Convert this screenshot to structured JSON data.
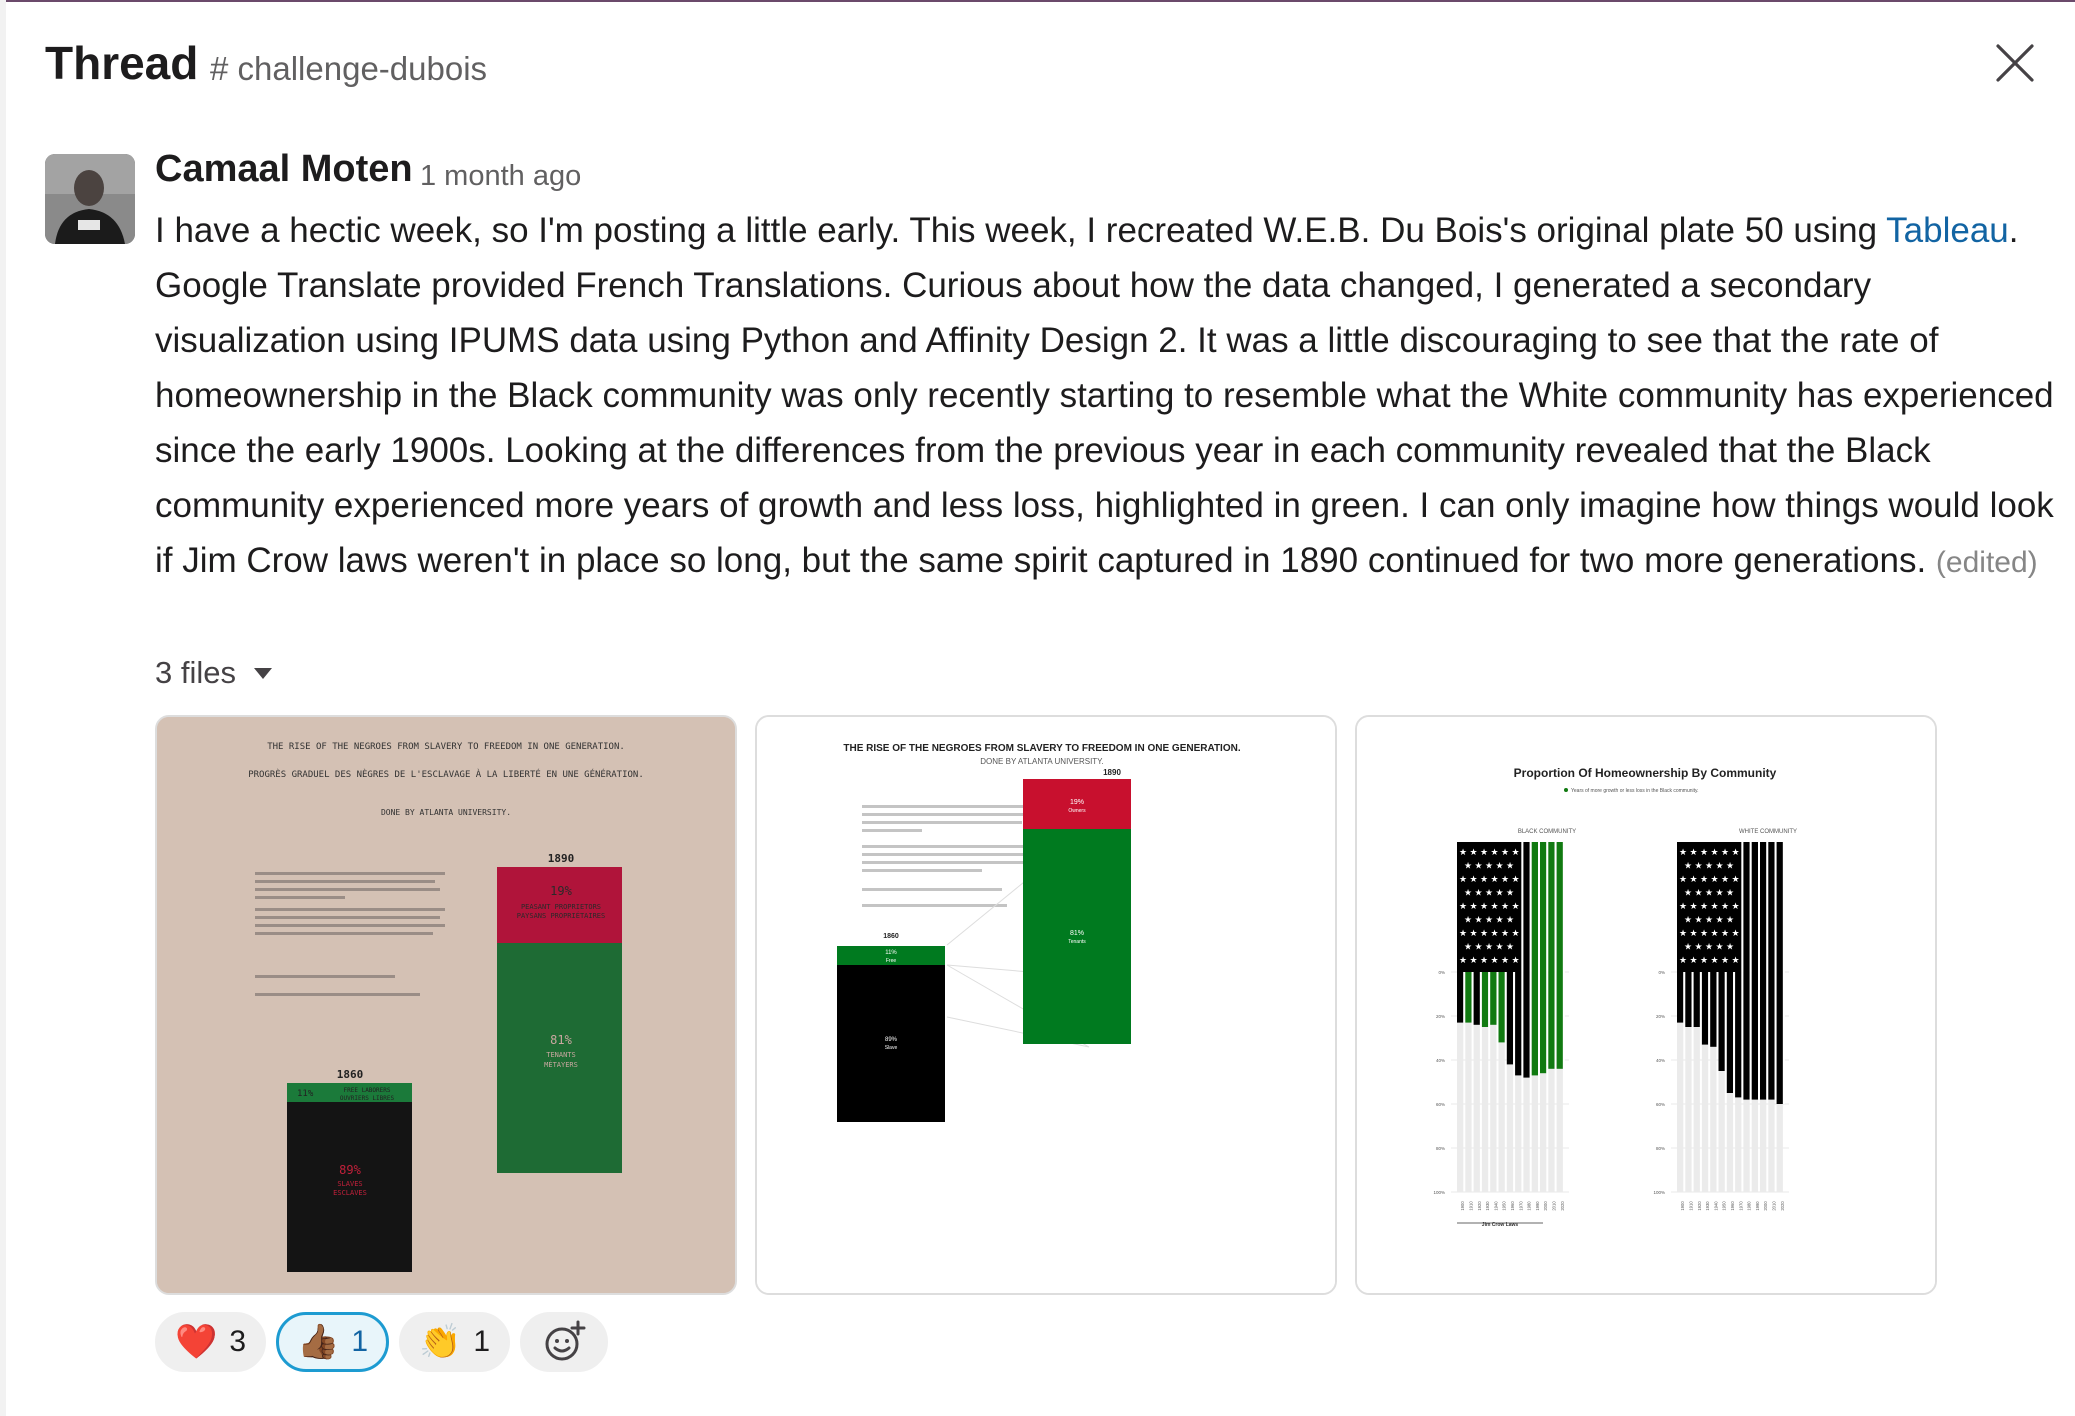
{
  "header": {
    "title": "Thread",
    "channel": "# challenge-dubois"
  },
  "message": {
    "author": "Camaal Moten",
    "timestamp": "1 month ago",
    "text_part1": "I have a hectic week, so I'm posting a little early. This week, I recreated W.E.B. Du Bois's original plate 50 using ",
    "link_text": "Tableau",
    "text_part2": ". Google Translate provided French Translations. Curious about how the data changed, I generated a secondary visualization using IPUMS data using Python and Affinity Design 2. It was a little discouraging to see that the rate of homeownership in the Black community was only recently starting to resemble what the White community has experienced since the early 1900s. Looking at the differences from the previous year in each community revealed that the Black community experienced more years of growth and less loss, highlighted in green. I can only imagine how things would look if Jim Crow laws weren't in place so long, but the same spirit captured in 1890 continued for two more generations. ",
    "edited": "(edited)",
    "files_label": "3 files"
  },
  "files": {
    "plate1": {
      "title_line1": "THE RISE OF THE NEGROES FROM SLAVERY TO FREEDOM IN ONE GENERATION.",
      "title_line2": "PROGRÈS GRADUEL DES NÈGRES DE L'ESCLAVAGE À LA LIBERTÉ EN UNE GÉNÉRATION.",
      "credit": "DONE BY ATLANTA UNIVERSITY.",
      "year_1890": "1890",
      "year_1860": "1860",
      "pct_19": "19%",
      "pct_81": "81%",
      "pct_11": "11%",
      "pct_89": "89%",
      "label_owners": "PEASANT PROPRIETORS",
      "label_owners_fr": "PAYSANS PROPRIÉTAIRES",
      "label_tenants": "TENANTS",
      "label_tenants_fr": "MÉTAYERS",
      "label_free": "FREE LABORERS",
      "label_free_fr": "OUVRIERS LIBRES",
      "label_slaves": "SLAVES",
      "label_slaves_fr": "ESCLAVES"
    },
    "plate2": {
      "title": "THE RISE OF THE NEGROES FROM SLAVERY TO FREEDOM IN ONE GENERATION.",
      "credit": "DONE BY ATLANTA UNIVERSITY.",
      "note1": "IN 1890 NEARLY ONE FIFTH OF THEM OWNED THEIR OWN HOMES AND FARMS. THIS ADVANCE WAS ACCOMPLISHED ENTIRELY WITHOUT STATE AID, AND IN THE FACE OF PROSCRIPTIVE LAWS.",
      "note2": "EN 1890, PRÈS D'UN CINQUIÈME D'ENTRE EUX POSSÉDAIENT LEUR PROPRE MAISON ET FERME. CETTE AVANCÉE A ÉTÉ RÉALISÉE ENTIÈREMENT SANS AIDE DE L'ÉTAT ET FACE À DES LOIS PROSCRIPTIVES.",
      "note3": "IN 1860 89% OF THE BLACKS WERE SLAVES.",
      "note4": "EN 1860, 90 % DES NOIRS ÉTAIT DES ESCLAVES.",
      "year_1890": "1890",
      "year_1860": "1860",
      "owners_pct": "19%",
      "owners_label": "Owners",
      "tenants_pct": "81%",
      "tenants_label": "Tenants",
      "free_pct": "11%",
      "free_label": "Free",
      "slave_pct": "89%",
      "slave_label": "Slave"
    },
    "plate3": {
      "title": "Proportion Of Homeownership By Community",
      "legend": "Years of more growth or less loss in the Black community.",
      "black_label": "BLACK COMMUNITY",
      "white_label": "WHITE COMMUNITY",
      "y_ticks": [
        "0%",
        "20%",
        "40%",
        "60%",
        "80%",
        "100%"
      ],
      "x_ticks": [
        "1900",
        "1910",
        "1920",
        "1930",
        "1940",
        "1950",
        "1960",
        "1970",
        "1980",
        "1990",
        "2000",
        "2010",
        "2020"
      ],
      "jim_crow": "Jim Crow Laws",
      "colors": {
        "black": "#000000",
        "green": "#117a11",
        "grey": "#ebebeb"
      }
    }
  },
  "reactions": [
    {
      "emoji": "❤️",
      "count": "3",
      "name": "heart"
    },
    {
      "emoji": "👍🏾",
      "count": "1",
      "name": "thumbsup"
    },
    {
      "emoji": "👏",
      "count": "1",
      "name": "clap"
    }
  ],
  "chart_data": [
    {
      "type": "bar",
      "title": "THE RISE OF THE NEGROES FROM SLAVERY TO FREEDOM IN ONE GENERATION.",
      "categories": [
        "1860",
        "1890"
      ],
      "series": [
        {
          "name": "Slave",
          "values": [
            89,
            0
          ]
        },
        {
          "name": "Free",
          "values": [
            11,
            0
          ]
        },
        {
          "name": "Tenants",
          "values": [
            0,
            81
          ]
        },
        {
          "name": "Owners",
          "values": [
            0,
            19
          ]
        }
      ]
    },
    {
      "type": "bar",
      "title": "Proportion Of Homeownership By Community",
      "categories": [
        "1900",
        "1910",
        "1920",
        "1930",
        "1940",
        "1950",
        "1960",
        "1970",
        "1980",
        "1990",
        "2000",
        "2010",
        "2020"
      ],
      "series": [
        {
          "name": "BLACK COMMUNITY",
          "values": [
            77,
            77,
            76,
            75,
            76,
            68,
            58,
            53,
            52,
            53,
            54,
            56,
            56
          ]
        },
        {
          "name": "WHITE COMMUNITY",
          "values": [
            77,
            75,
            75,
            67,
            66,
            55,
            45,
            43,
            42,
            42,
            42,
            42,
            40
          ]
        }
      ],
      "ylim": [
        0,
        100
      ]
    }
  ]
}
